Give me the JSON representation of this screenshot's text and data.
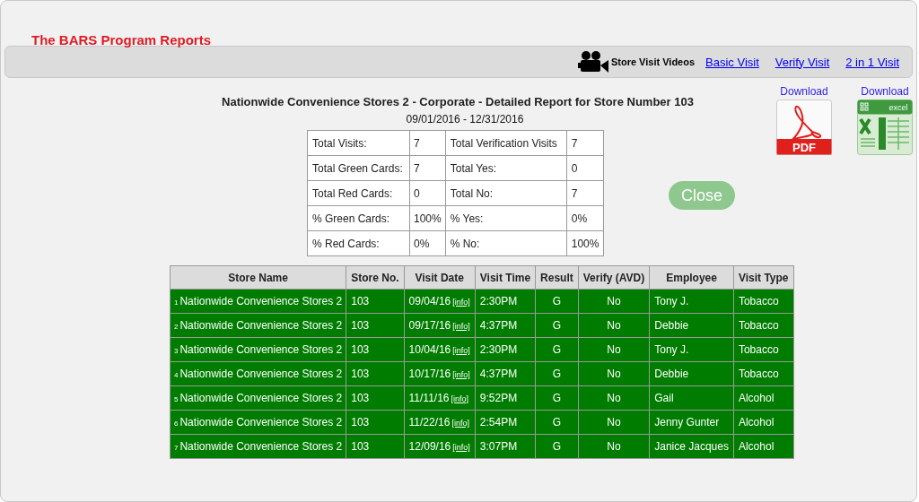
{
  "app_title": "The BARS Program Reports",
  "toolbar": {
    "label": "Store Visit Videos",
    "links": [
      "Basic Visit",
      "Verify Visit",
      "2 in 1 Visit"
    ]
  },
  "report": {
    "title": "Nationwide Convenience Stores 2 - Corporate - Detailed Report for Store Number 103",
    "date_range": "09/01/2016 - 12/31/2016"
  },
  "downloads": [
    {
      "kind": "pdf",
      "label": "Download",
      "icon_text": "PDF"
    },
    {
      "kind": "excel",
      "label": "Download",
      "icon_text": "excel"
    }
  ],
  "summary": [
    [
      "Total Visits:",
      "7",
      "Total Verification Visits",
      "7"
    ],
    [
      "Total Green Cards:",
      "7",
      "Total Yes:",
      "0"
    ],
    [
      "Total Red Cards:",
      "0",
      "Total No:",
      "7"
    ],
    [
      "% Green Cards:",
      "100%",
      "% Yes:",
      "0%"
    ],
    [
      "% Red Cards:",
      "0%",
      "% No:",
      "100%"
    ]
  ],
  "close_button": "Close",
  "table": {
    "columns": [
      "Store Name",
      "Store No.",
      "Visit Date",
      "Visit Time",
      "Result",
      "Verify (AVD)",
      "Employee",
      "Visit Type"
    ],
    "rows": [
      {
        "number": "1",
        "store_name": "Nationwide Convenience Stores 2",
        "store_no": "103",
        "visit_date": "09/04/16",
        "info": "[info]",
        "visit_time": "2:30PM",
        "result": "G",
        "verify": "No",
        "employee": "Tony J.",
        "visit_type": "Tobacco"
      },
      {
        "number": "2",
        "store_name": "Nationwide Convenience Stores 2",
        "store_no": "103",
        "visit_date": "09/17/16",
        "info": "[info]",
        "visit_time": "4:37PM",
        "result": "G",
        "verify": "No",
        "employee": "Debbie",
        "visit_type": "Tobacco"
      },
      {
        "number": "3",
        "store_name": "Nationwide Convenience Stores 2",
        "store_no": "103",
        "visit_date": "10/04/16",
        "info": "[info]",
        "visit_time": "2:30PM",
        "result": "G",
        "verify": "No",
        "employee": "Tony J.",
        "visit_type": "Tobacco"
      },
      {
        "number": "4",
        "store_name": "Nationwide Convenience Stores 2",
        "store_no": "103",
        "visit_date": "10/17/16",
        "info": "[info]",
        "visit_time": "4:37PM",
        "result": "G",
        "verify": "No",
        "employee": "Debbie",
        "visit_type": "Tobacco"
      },
      {
        "number": "5",
        "store_name": "Nationwide Convenience Stores 2",
        "store_no": "103",
        "visit_date": "11/11/16",
        "info": "[info]",
        "visit_time": "9:52PM",
        "result": "G",
        "verify": "No",
        "employee": "Gail",
        "visit_type": "Alcohol"
      },
      {
        "number": "6",
        "store_name": "Nationwide Convenience Stores 2",
        "store_no": "103",
        "visit_date": "11/22/16",
        "info": "[info]",
        "visit_time": "2:54PM",
        "result": "G",
        "verify": "No",
        "employee": "Jenny Gunter",
        "visit_type": "Alcohol"
      },
      {
        "number": "7",
        "store_name": "Nationwide Convenience Stores 2",
        "store_no": "103",
        "visit_date": "12/09/16",
        "info": "[info]",
        "visit_time": "3:07PM",
        "result": "G",
        "verify": "No",
        "employee": "Janice Jacques",
        "visit_type": "Alcohol"
      }
    ]
  }
}
